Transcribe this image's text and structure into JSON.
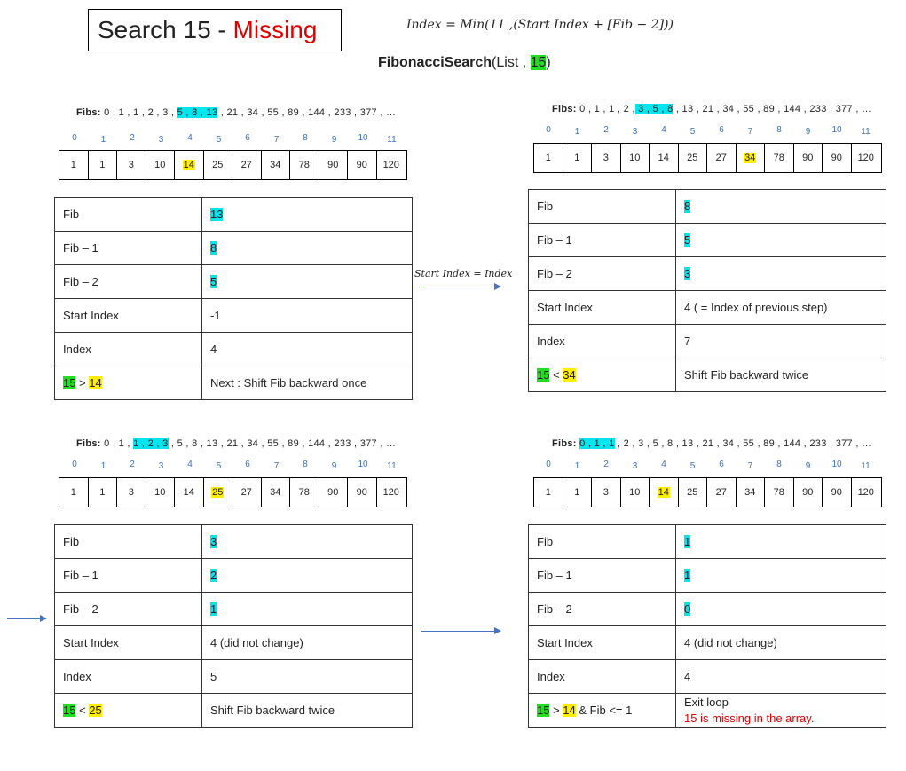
{
  "title": {
    "prefix": "Search 15  - ",
    "status": "Missing"
  },
  "formula": "Index = Min(11 ,(Start Index + [Fib − 2]))",
  "call": {
    "fn": "FibonacciSearch",
    "args_prefix": "(List , ",
    "target": "15",
    "args_suffix": ")"
  },
  "array": [
    "1",
    "1",
    "3",
    "10",
    "14",
    "25",
    "27",
    "34",
    "78",
    "90",
    "90",
    "120"
  ],
  "indices": [
    "0",
    "1",
    "2",
    "3",
    "4",
    "5",
    "6",
    "7",
    "8",
    "9",
    "10",
    "11"
  ],
  "fibs_label": "Fibs:",
  "between_label": "Start Index = Index",
  "steps": [
    {
      "fibs_before": "0 , 1 , 1 , 2 , 3 , ",
      "fibs_hl": "5 , 8 , 13",
      "fibs_after": " , 21 , 34 , 55 , 89 , 144 , 233 , 377 , …",
      "probe": "4",
      "rows": [
        {
          "k": "Fib",
          "v": "13"
        },
        {
          "k": "Fib – 1",
          "v": "8"
        },
        {
          "k": "Fib – 2",
          "v": "5"
        },
        {
          "k": "Start Index",
          "v": "-1"
        },
        {
          "k": "Index",
          "v": "4"
        }
      ],
      "cmp": {
        "a": "15",
        "op": " > ",
        "b": "14",
        "extra": ""
      },
      "result": "Next : Shift Fib backward once",
      "result2": ""
    },
    {
      "fibs_before": "0 , 1 , 1 , 2 ,",
      "fibs_hl": " 3 , 5 , 8",
      "fibs_after": " , 13 , 21 , 34 , 55 , 89 , 144 , 233 , 377 , …",
      "probe": "7",
      "rows": [
        {
          "k": "Fib",
          "v": "8"
        },
        {
          "k": "Fib – 1",
          "v": "5"
        },
        {
          "k": "Fib – 2",
          "v": "3"
        },
        {
          "k": "Start Index",
          "v": "4  ( = Index of previous step)"
        },
        {
          "k": "Index",
          "v": "7"
        }
      ],
      "cmp": {
        "a": "15",
        "op": " < ",
        "b": "34",
        "extra": ""
      },
      "result": "Shift Fib backward twice",
      "result2": ""
    },
    {
      "fibs_before": "0 , 1 , ",
      "fibs_hl": "1 , 2 , 3",
      "fibs_after": " , 5 , 8 , 13 , 21 , 34 , 55 , 89 , 144 , 233 , 377 , …",
      "probe": "5",
      "rows": [
        {
          "k": "Fib",
          "v": "3"
        },
        {
          "k": "Fib – 1",
          "v": "2"
        },
        {
          "k": "Fib – 2",
          "v": "1"
        },
        {
          "k": "Start Index",
          "v": "4 (did not change)"
        },
        {
          "k": "Index",
          "v": "5"
        }
      ],
      "cmp": {
        "a": "15",
        "op": " < ",
        "b": "25",
        "extra": ""
      },
      "result": "Shift Fib backward twice",
      "result2": ""
    },
    {
      "fibs_before": "",
      "fibs_hl": "0 , 1 , 1",
      "fibs_after": " , 2 , 3 , 5 , 8 , 13 , 21 , 34 , 55 , 89 , 144 , 233 , 377 , …",
      "probe": "4",
      "rows": [
        {
          "k": "Fib",
          "v": "1"
        },
        {
          "k": "Fib – 1",
          "v": "1"
        },
        {
          "k": "Fib – 2",
          "v": "0"
        },
        {
          "k": "Start Index",
          "v": "4 (did not change)"
        },
        {
          "k": "Index",
          "v": "4"
        }
      ],
      "cmp": {
        "a": "15",
        "op": " > ",
        "b": "14",
        "extra": " & Fib <= 1"
      },
      "result": "Exit loop",
      "result2": "15 is missing in the array."
    }
  ],
  "colors": {
    "green": "#22dd22",
    "yellow": "#ffee00",
    "cyan": "#00e5ee",
    "red": "#e00000",
    "blue": "#4472c4"
  }
}
